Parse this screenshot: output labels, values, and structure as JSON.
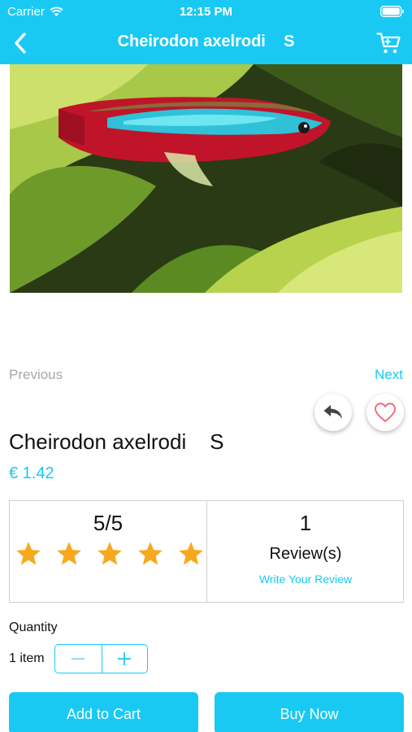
{
  "status_bar": {
    "carrier": "Carrier",
    "time": "12:15 PM"
  },
  "nav": {
    "title": "Cheirodon axelrodi    S",
    "back_icon": "chevron-left-icon",
    "cart_icon": "cart-icon"
  },
  "pager": {
    "previous": "Previous",
    "next": "Next"
  },
  "actions": {
    "share_icon": "reply-arrow-icon",
    "favorite_icon": "heart-outline-icon"
  },
  "product": {
    "name": "Cheirodon axelrodi    S",
    "price": "€ 1.42"
  },
  "rating": {
    "score": "5/5",
    "stars_filled": 5,
    "stars_total": 5,
    "reviews_count": "1",
    "reviews_label": "Review(s)",
    "write_review": "Write Your Review"
  },
  "quantity": {
    "label": "Quantity",
    "value": "1 item"
  },
  "buttons": {
    "add_to_cart": "Add to Cart",
    "buy_now": "Buy Now"
  },
  "colors": {
    "accent": "#19c9f3",
    "star": "#f7a91d",
    "muted": "#a8a8a8",
    "heart": "#f0606f"
  }
}
